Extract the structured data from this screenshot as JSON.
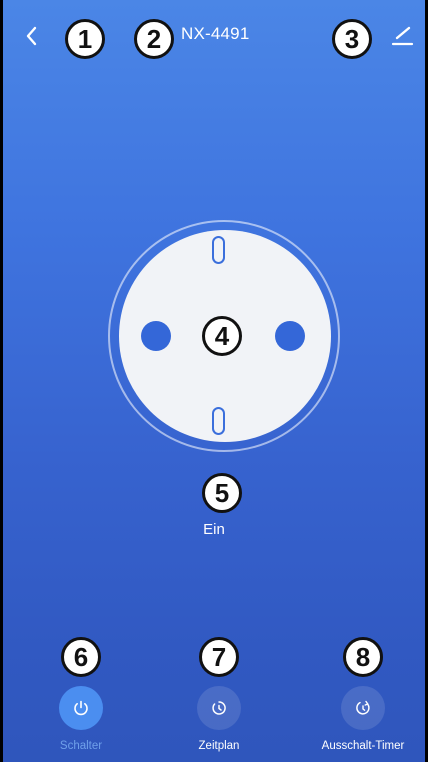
{
  "header": {
    "device_name": "NX-4491",
    "back_icon": "chevron-left-icon",
    "edit_icon": "pencil-edit-icon"
  },
  "markers": [
    "1",
    "2",
    "3",
    "4",
    "5",
    "6",
    "7",
    "8"
  ],
  "socket": {
    "state_label": "Ein",
    "is_on": true
  },
  "tabs": [
    {
      "label": "Schalter",
      "icon": "power-icon",
      "active": true
    },
    {
      "label": "Zeitplan",
      "icon": "schedule-clock-icon",
      "active": false
    },
    {
      "label": "Ausschalt-Timer",
      "icon": "countdown-timer-icon",
      "active": false
    }
  ],
  "colors": {
    "background_top": "#4b86e6",
    "background_bottom": "#2f56bc",
    "socket_face": "#f1f3f7",
    "accent_blue": "#3467d8",
    "active_tab": "#4b8ef0"
  }
}
